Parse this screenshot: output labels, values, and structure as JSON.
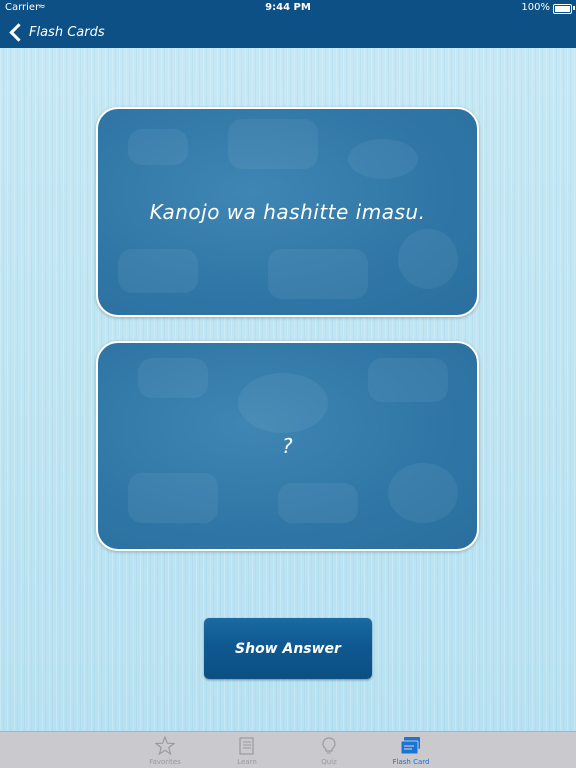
{
  "status": {
    "carrier": "Carrier",
    "time": "9:44 PM",
    "battery": "100%"
  },
  "nav": {
    "back_label": "Flash Cards"
  },
  "cards": {
    "front_text": "Kanojo wa hashitte imasu.",
    "back_text": "?"
  },
  "actions": {
    "show_answer_label": "Show Answer"
  },
  "tabs": [
    {
      "label": "Favorites",
      "icon": "star-icon",
      "active": false
    },
    {
      "label": "Learn",
      "icon": "notebook-icon",
      "active": false
    },
    {
      "label": "Quiz",
      "icon": "lightbulb-icon",
      "active": false
    },
    {
      "label": "Flash Card",
      "icon": "flash-card-icon",
      "active": true
    }
  ],
  "colors": {
    "bar": "#0c5085",
    "card": "#2f76a6",
    "tab_active": "#1a73d6",
    "tab_inactive": "#9a9aa0"
  }
}
